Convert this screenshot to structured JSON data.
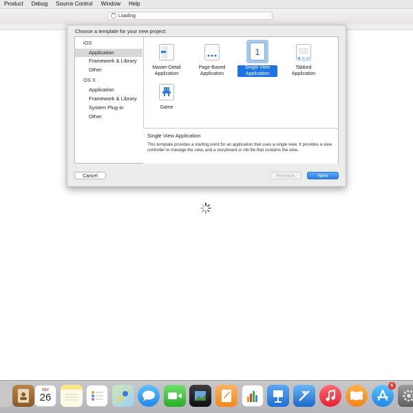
{
  "menubar": {
    "items": [
      "Product",
      "Debug",
      "Source Control",
      "Window",
      "Help"
    ]
  },
  "toolbar": {
    "activity_text": "Loading"
  },
  "sheet": {
    "title": "Choose a template for your new project:",
    "sidebar": {
      "ios_header": "iOS",
      "ios_items": [
        "Application",
        "Framework & Library",
        "Other"
      ],
      "osx_header": "OS X",
      "osx_items": [
        "Application",
        "Framework & Library",
        "System Plug-in",
        "Other"
      ],
      "selected": "iOS Application"
    },
    "templates": [
      {
        "label": "Master-Detail Application",
        "icon": "master-detail-icon"
      },
      {
        "label": "Page-Based Application",
        "icon": "page-based-icon"
      },
      {
        "label": "Single View Application",
        "icon": "single-view-icon",
        "selected": true,
        "icon_glyph": "1"
      },
      {
        "label": "Tabbed Application",
        "icon": "tabbed-icon"
      },
      {
        "label": "Game",
        "icon": "game-icon"
      }
    ],
    "description": {
      "title": "Single View Application",
      "body": "This template provides a starting point for an application that uses a single view. It provides a view controller to manage the view, and a storyboard or nib file that contains the view."
    },
    "buttons": {
      "cancel": "Cancel",
      "previous": "Previous",
      "next": "Next"
    }
  },
  "dock": {
    "calendar_month": "FEV",
    "calendar_day": "26",
    "app_store_badge": "6",
    "icons": [
      "contacts-icon",
      "calendar-icon",
      "notes-icon",
      "reminders-icon",
      "maps-icon",
      "messages-icon",
      "facetime-icon",
      "photo-booth-icon",
      "pages-icon",
      "numbers-icon",
      "keynote-icon",
      "xcode-icon",
      "itunes-icon",
      "ibooks-icon",
      "app-store-icon",
      "system-preferences-icon"
    ]
  },
  "colors": {
    "accent": "#1d73e6",
    "selection_bg": "#a6c7ee"
  }
}
